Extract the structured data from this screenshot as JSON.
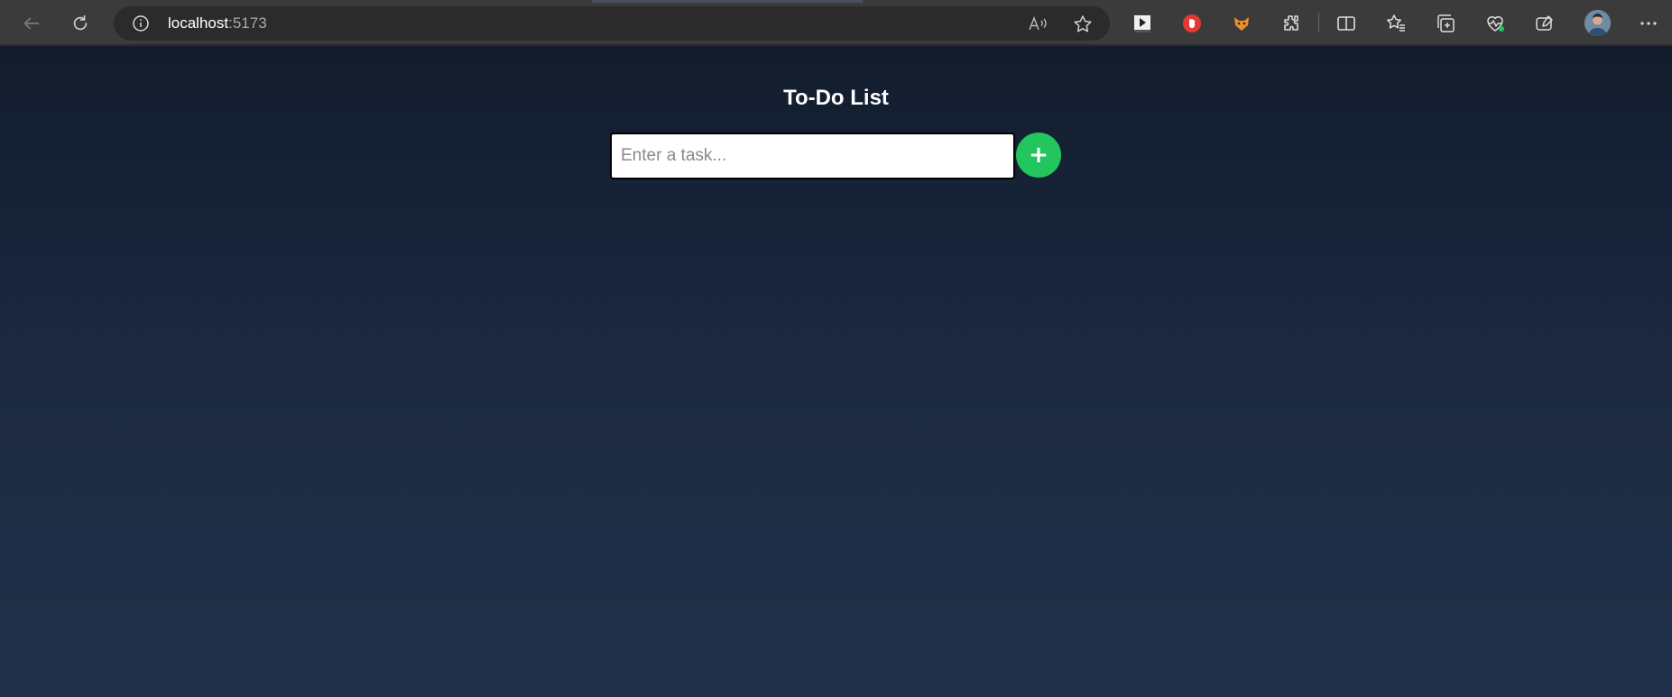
{
  "browser": {
    "url_host": "localhost",
    "url_port": ":5173",
    "read_aloud_icon": "read-aloud-icon",
    "toolbar_icons": [
      "media-icon",
      "adblock-icon",
      "extension-fox-icon",
      "extensions-icon",
      "split-screen-icon",
      "favorites-icon",
      "collections-icon",
      "health-icon",
      "copilot-icon",
      "profile-avatar",
      "more-icon"
    ]
  },
  "app": {
    "title": "To-Do List",
    "input": {
      "placeholder": "Enter a task...",
      "value": ""
    },
    "add_button_label": "+"
  },
  "colors": {
    "add_button": "#22c55e",
    "background_top": "#121c2d",
    "background_bottom": "#213049",
    "adblock_red": "#e53935"
  }
}
